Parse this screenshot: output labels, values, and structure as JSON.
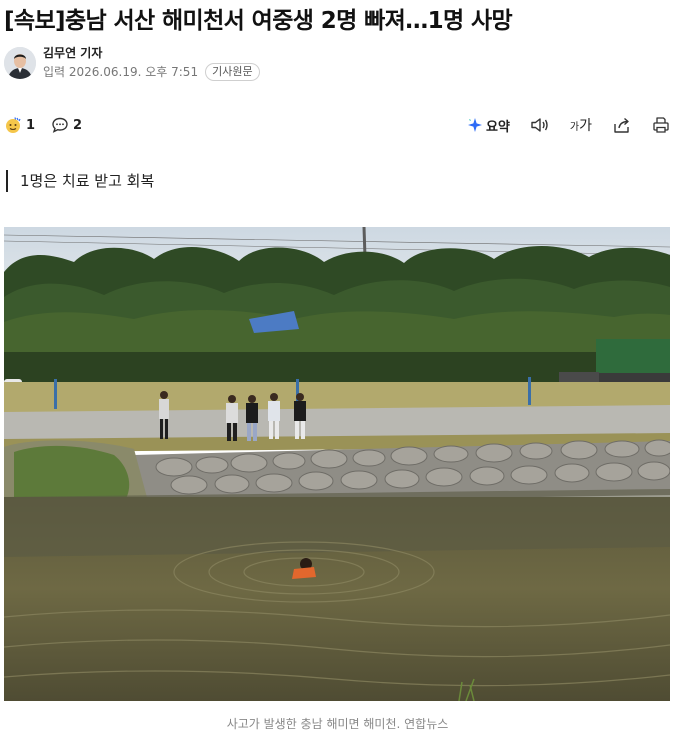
{
  "article": {
    "headline": "[속보]충남 서산 해미천서 여중생 2명 빠져…1명 사망",
    "author": "김무연 기자",
    "date": "입력 2026.06.19. 오후 7:51",
    "original_badge": "기사원문",
    "subhead": "1명은 치료 받고 회복",
    "caption": "사고가 발생한 충남 해미면 해미천. 연합뉴스"
  },
  "toolbar": {
    "reaction_count": "1",
    "comment_count": "2",
    "summary_label": "요약",
    "fontsize_small": "가",
    "fontsize_large": "가"
  },
  "icons": {
    "reaction": "reaction-emoji-icon",
    "comment": "speech-bubble-icon",
    "summary": "summary-sparkle-icon",
    "audio": "speaker-icon",
    "font_size": "font-size-icon",
    "share": "share-icon",
    "print": "print-icon"
  },
  "colors": {
    "summary_accent": "#2d6cf6",
    "reaction_face": "#f5c64a"
  }
}
